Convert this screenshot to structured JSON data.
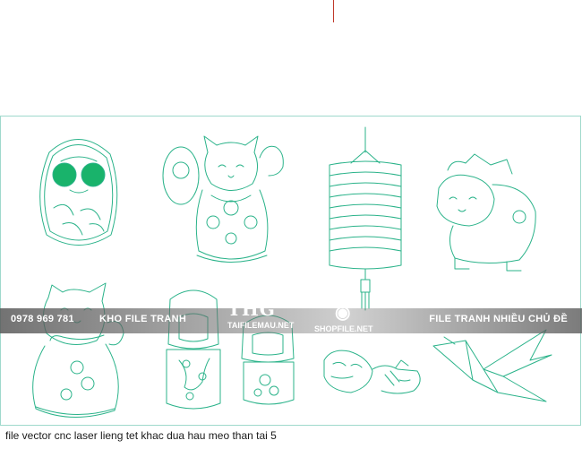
{
  "watermark": {
    "phone": "0978 969 781",
    "shop_name": "KHO FILE TRANH",
    "tagline": "FILE TRANH NHIỀU CHỦ ĐỀ",
    "logo_text": "THG",
    "logo_subtext": "TAIFILEMAU.NET",
    "eye_subtext": "SHOPFILE.NET",
    "band_color": "#5a5a5a"
  },
  "caption": "file vector cnc laser lieng tet khac dua hau meo than tai 5",
  "colors": {
    "line": "#2bb38a",
    "fill": "#19b36b",
    "frame": "#9fd9cc"
  },
  "artwork": [
    {
      "icon": "daruma-icon"
    },
    {
      "icon": "lucky-cat-waving-icon"
    },
    {
      "icon": "paper-lantern-icon"
    },
    {
      "icon": "dog-figurine-icon"
    },
    {
      "icon": "lucky-cat-sitting-icon"
    },
    {
      "icon": "kokeshi-doll-large-icon"
    },
    {
      "icon": "kokeshi-doll-small-icon"
    },
    {
      "icon": "tiger-toy-icon"
    },
    {
      "icon": "paper-crane-icon"
    }
  ]
}
